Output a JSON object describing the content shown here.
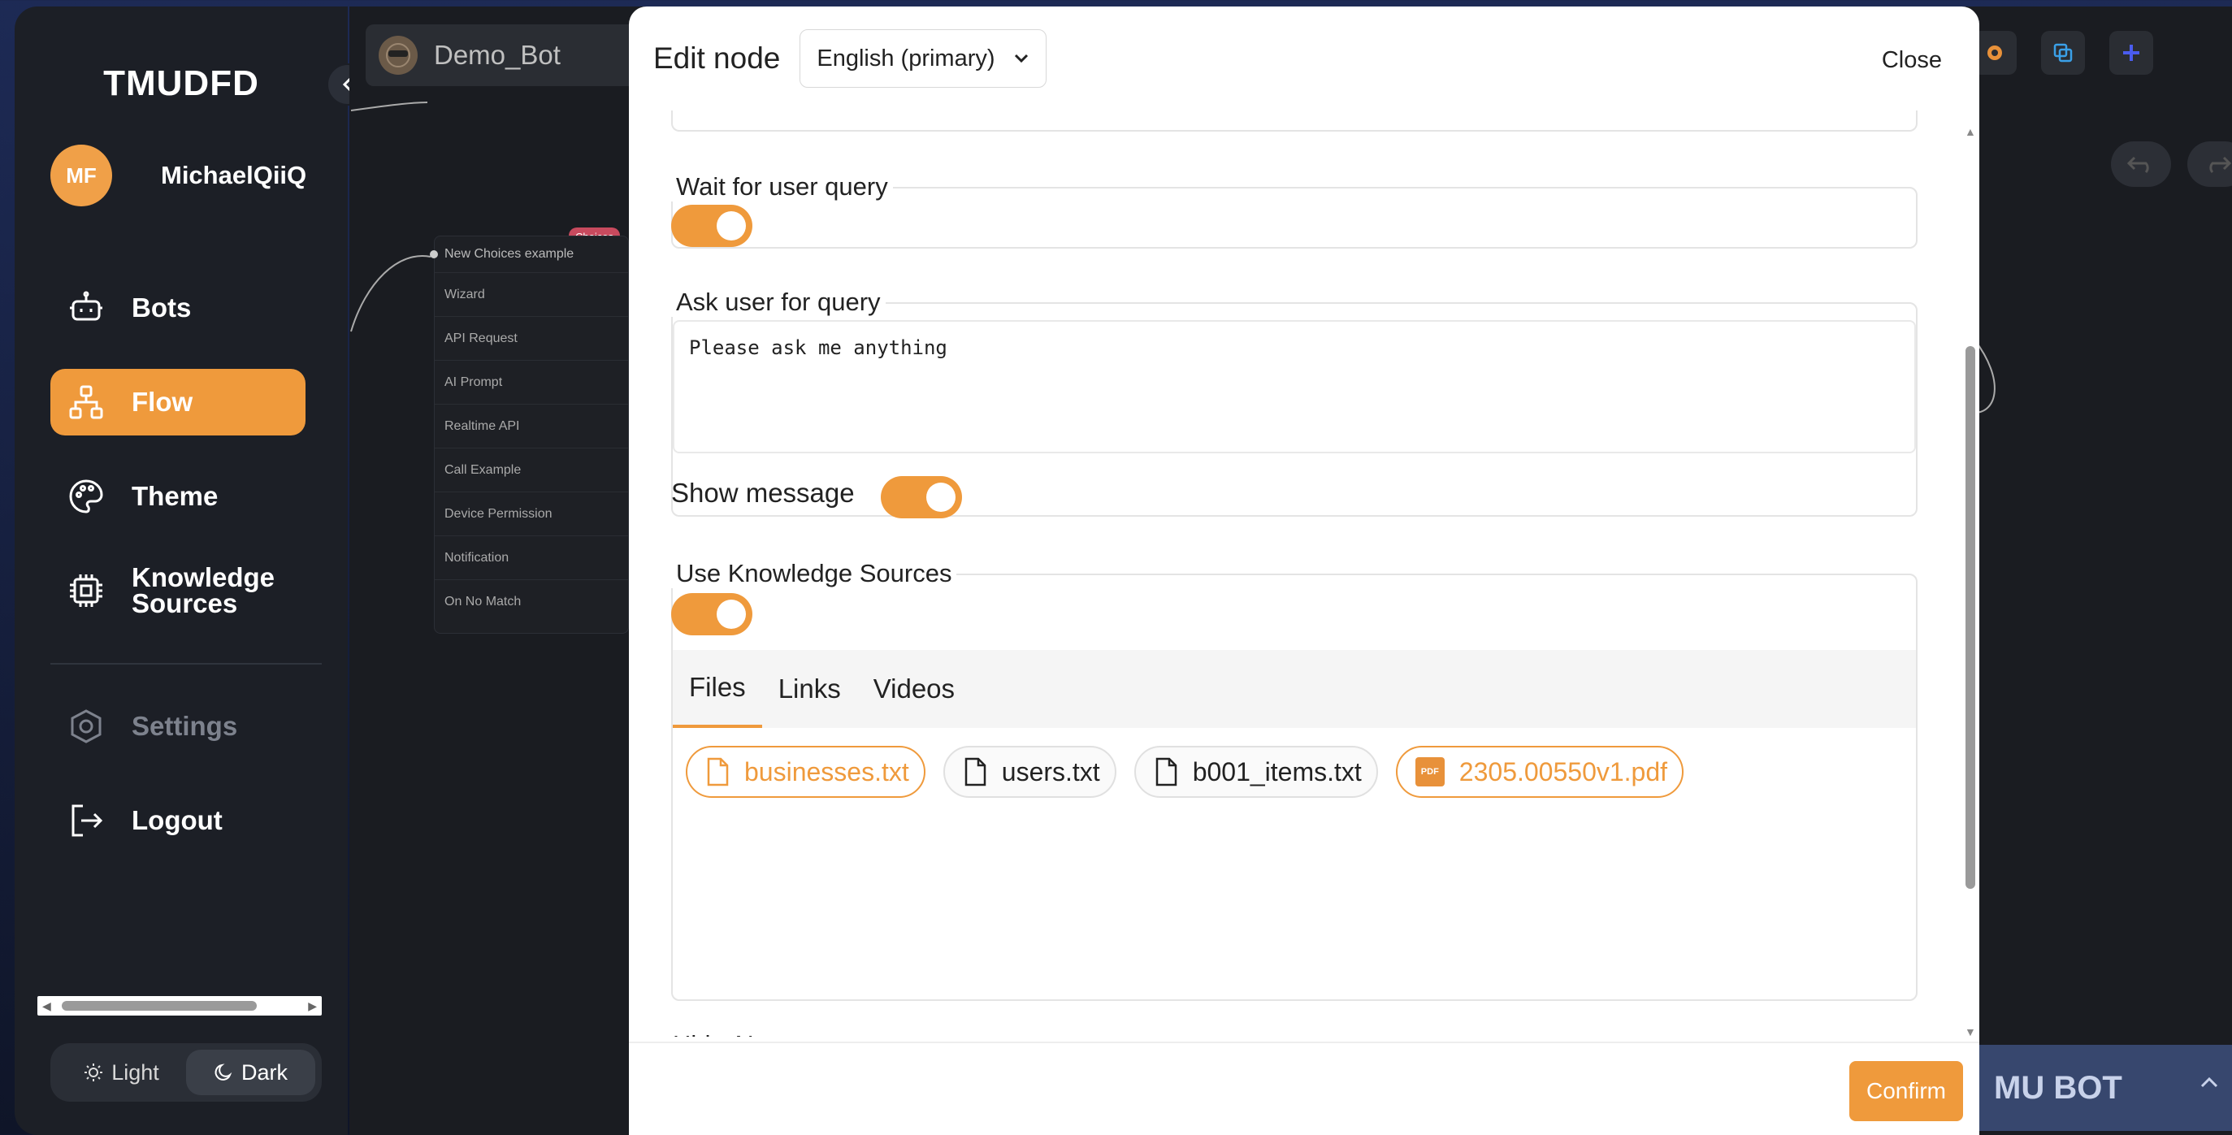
{
  "sidebar": {
    "brand": "TMUDFD",
    "user": {
      "initials": "MF",
      "name": "MichaelQiiQ"
    },
    "nav": [
      {
        "label": "Bots",
        "icon": "robot-icon",
        "active": false
      },
      {
        "label": "Flow",
        "icon": "flow-icon",
        "active": true
      },
      {
        "label": "Theme",
        "icon": "palette-icon",
        "active": false
      },
      {
        "label": "Knowledge Sources",
        "label_line1": "Knowledge",
        "label_line2": "Sources",
        "icon": "chip-icon",
        "active": false
      }
    ],
    "settings_label": "Settings",
    "logout_label": "Logout",
    "theme": {
      "light_label": "Light",
      "dark_label": "Dark",
      "selected": "Dark"
    }
  },
  "canvas": {
    "bot_name": "Demo_Bot",
    "node": {
      "tag": "Choices",
      "title": "New Choices example",
      "items": [
        "Wizard",
        "API Request",
        "AI Prompt",
        "Realtime API",
        "Call Example",
        "Device Permission",
        "Notification",
        "On No Match"
      ]
    },
    "footer_label": "MU BOT"
  },
  "modal": {
    "title": "Edit node",
    "language": "English (primary)",
    "close_label": "Close",
    "wait_for_user_query": {
      "label": "Wait for user query",
      "enabled": true
    },
    "ask_user_for_query": {
      "label": "Ask user for query",
      "value": "Please ask me anything"
    },
    "show_message": {
      "label": "Show message",
      "enabled": true
    },
    "use_knowledge_sources": {
      "label": "Use Knowledge Sources",
      "enabled": true
    },
    "tabs": [
      {
        "label": "Files",
        "selected": true
      },
      {
        "label": "Links",
        "selected": false
      },
      {
        "label": "Videos",
        "selected": false
      }
    ],
    "files": [
      {
        "name": "businesses.txt",
        "type": "txt",
        "selected": true
      },
      {
        "name": "users.txt",
        "type": "txt",
        "selected": false
      },
      {
        "name": "b001_items.txt",
        "type": "txt",
        "selected": false
      },
      {
        "name": "2305.00550v1.pdf",
        "type": "pdf",
        "selected": true
      }
    ],
    "next_section_label": "Hide AI",
    "confirm_label": "Confirm"
  },
  "colors": {
    "accent": "#ef9a3c",
    "sidebar_bg": "#1c1f26",
    "canvas_bg": "#1a1c21"
  }
}
